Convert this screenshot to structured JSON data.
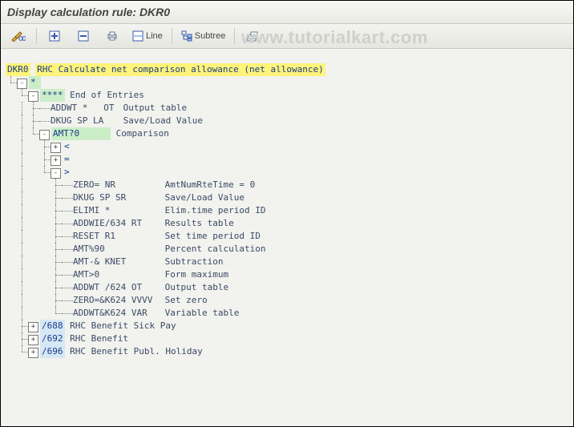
{
  "title": "Display calculation rule: DKR0",
  "watermark": "www.tutorialkart.com",
  "toolbar": {
    "line_label": "Line",
    "subtree_label": "Subtree"
  },
  "rule": {
    "code": "DKR0",
    "desc": "RHC Calculate net comparison allowance (net allowance)"
  },
  "tree": {
    "star_label": "*",
    "end_entries": {
      "code": "****",
      "desc": "End of Entries"
    },
    "items_lvl3": [
      {
        "code": "ADDWT *   OT",
        "desc": "Output table"
      },
      {
        "code": "DKUG SP LA",
        "desc": "Save/Load Value"
      }
    ],
    "comparison": {
      "code": "AMT?0",
      "desc": "Comparison"
    },
    "cmp_ops": [
      "<",
      "=",
      ">"
    ],
    "gt_children": [
      {
        "code": "ZERO= NR",
        "desc": "AmtNumRteTime = 0"
      },
      {
        "code": "DKUG SP SR",
        "desc": "Save/Load Value"
      },
      {
        "code": "ELIMI *",
        "desc": "Elim.time period ID"
      },
      {
        "code": "ADDWIE/634 RT",
        "desc": "Results table"
      },
      {
        "code": "RESET R1",
        "desc": "Set time period ID"
      },
      {
        "code": "AMT%90",
        "desc": "Percent calculation"
      },
      {
        "code": "AMT-& KNET",
        "desc": "Subtraction"
      },
      {
        "code": "AMT>0",
        "desc": "Form maximum"
      },
      {
        "code": "ADDWT /624 OT",
        "desc": "Output table"
      },
      {
        "code": "ZERO=&K624 VVVV",
        "desc": "Set zero"
      },
      {
        "code": "ADDWT&K624 VAR",
        "desc": "Variable table"
      }
    ],
    "wage_types": [
      {
        "code": "/688",
        "desc": "RHC Benefit Sick Pay"
      },
      {
        "code": "/692",
        "desc": "RHC Benefit"
      },
      {
        "code": "/696",
        "desc": "RHC Benefit Publ. Holiday"
      }
    ]
  },
  "chart_data": null
}
